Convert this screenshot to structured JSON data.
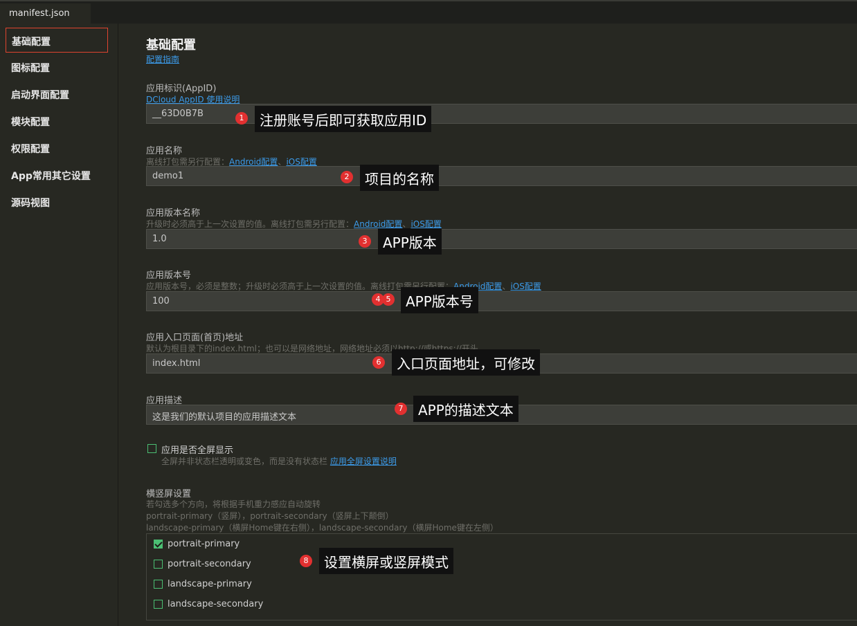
{
  "tab": {
    "label": "manifest.json"
  },
  "sidebar": {
    "items": [
      {
        "label": "基础配置"
      },
      {
        "label": "图标配置"
      },
      {
        "label": "启动界面配置"
      },
      {
        "label": "模块配置"
      },
      {
        "label": "权限配置"
      },
      {
        "label": "App常用其它设置"
      },
      {
        "label": "源码视图"
      }
    ]
  },
  "main": {
    "title": "基础配置",
    "guide_link": "配置指南",
    "appid": {
      "label": "应用标识(AppID)",
      "link": "DCloud AppID 使用说明",
      "value": "__63D0B7B"
    },
    "name": {
      "label": "应用名称",
      "hint": "离线打包需另行配置：",
      "android_link": "Android配置",
      "sep": "、",
      "ios_link": "iOS配置",
      "value": "demo1"
    },
    "version_name": {
      "label": "应用版本名称",
      "hint": "升级时必须高于上一次设置的值。离线打包需另行配置：",
      "android_link": "Android配置",
      "sep": "、",
      "ios_link": "iOS配置",
      "value": "1.0"
    },
    "version_code": {
      "label": "应用版本号",
      "hint": "应用版本号，必须是整数；升级时必须高于上一次设置的值。离线打包需另行配置：",
      "android_link": "Android配置",
      "sep": "、",
      "ios_link": "iOS配置",
      "value": "100"
    },
    "entry": {
      "label": "应用入口页面(首页)地址",
      "hint": "默认为根目录下的index.html；也可以是网络地址，网络地址必须以http://或https://开头",
      "value": "index.html"
    },
    "description": {
      "label": "应用描述",
      "value": "这是我们的默认项目的应用描述文本"
    },
    "fullscreen": {
      "label": "应用是否全屏显示",
      "hint": "全屏并非状态栏透明或变色，而是没有状态栏",
      "link": "应用全屏设置说明",
      "checked": false
    },
    "orientation": {
      "label": "横竖屏设置",
      "hint1": "若勾选多个方向，将根据手机重力感应自动旋转",
      "hint2": "portrait-primary（竖屏），portrait-secondary（竖屏上下颠倒）",
      "hint3": "landscape-primary（横屏Home键在右侧），landscape-secondary（横屏Home键在左侧）",
      "options": [
        {
          "label": "portrait-primary",
          "checked": true
        },
        {
          "label": "portrait-secondary",
          "checked": false
        },
        {
          "label": "landscape-primary",
          "checked": false
        },
        {
          "label": "landscape-secondary",
          "checked": false
        }
      ]
    }
  },
  "annotations": [
    {
      "num": "1",
      "text": "注册账号后即可获取应用ID"
    },
    {
      "num": "2",
      "text": "项目的名称"
    },
    {
      "num": "3",
      "text": "APP版本"
    },
    {
      "num": "4",
      "text": "4"
    },
    {
      "num": "5",
      "text": "APP版本号"
    },
    {
      "num": "6",
      "text": "入口页面地址，可修改"
    },
    {
      "num": "7",
      "text": "APP的描述文本"
    },
    {
      "num": "8",
      "text": "设置横屏或竖屏模式"
    }
  ],
  "colors": {
    "background": "#272822",
    "link": "#3c9bea",
    "active_border": "#e0442f",
    "checkbox": "#4bbf73",
    "badge": "#e23030"
  }
}
